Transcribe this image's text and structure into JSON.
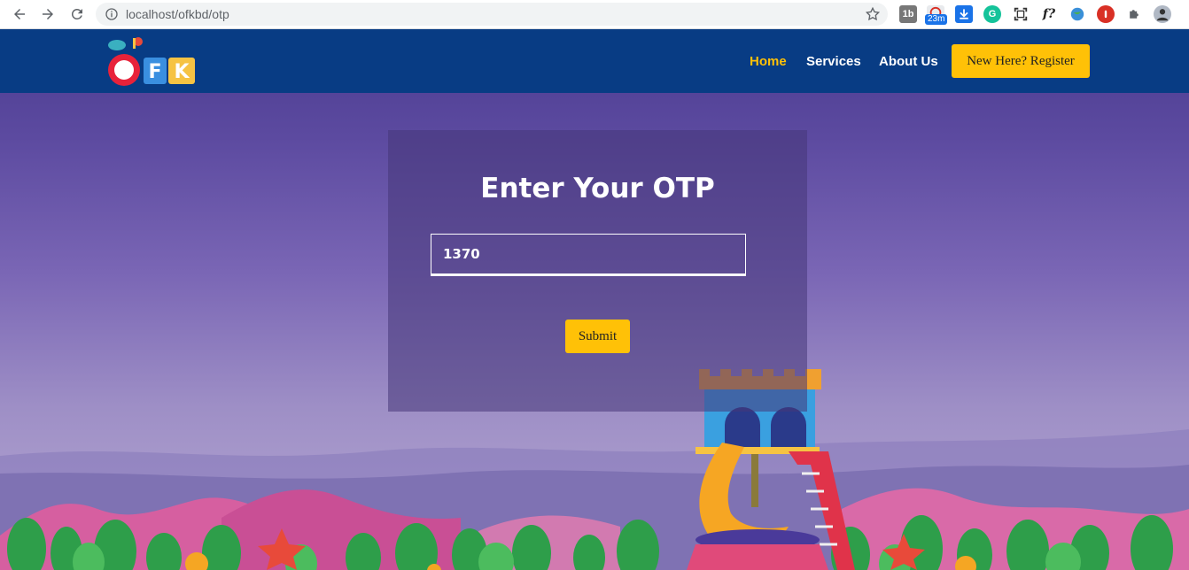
{
  "browser": {
    "url": "localhost/ofkbd/otp",
    "extension_badge": "23m"
  },
  "header": {
    "logo_text": "OFK",
    "nav": {
      "home": "Home",
      "services": "Services",
      "about": "About Us"
    },
    "register_label": "New Here? Register"
  },
  "otp": {
    "title": "Enter Your OTP",
    "value": "1370",
    "submit_label": "Submit"
  },
  "colors": {
    "header_bg": "#083c84",
    "accent": "#ffc107",
    "active_nav": "#ffc107"
  }
}
